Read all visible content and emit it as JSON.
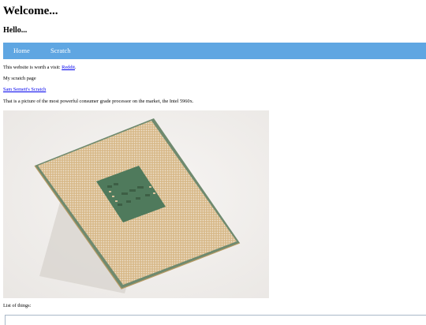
{
  "header": {
    "title": "Welcome...",
    "subtitle": "Hello..."
  },
  "nav": {
    "items": [
      {
        "label": "Home"
      },
      {
        "label": "Scratch"
      }
    ],
    "background": "#5fa6e2"
  },
  "content": {
    "visit_prefix": "This website is worth a visit: ",
    "visit_link": "Reddit",
    "visit_suffix": ".",
    "scratch_text": "My scratch page",
    "scratch_link": "Sam Semett's Scratch",
    "picture_caption": "That is a picture of the most powerful consumer grade processor on the market, the Intel 5960x.",
    "list_label": "List of things:"
  },
  "image": {
    "subject": "cpu-chip-image"
  }
}
